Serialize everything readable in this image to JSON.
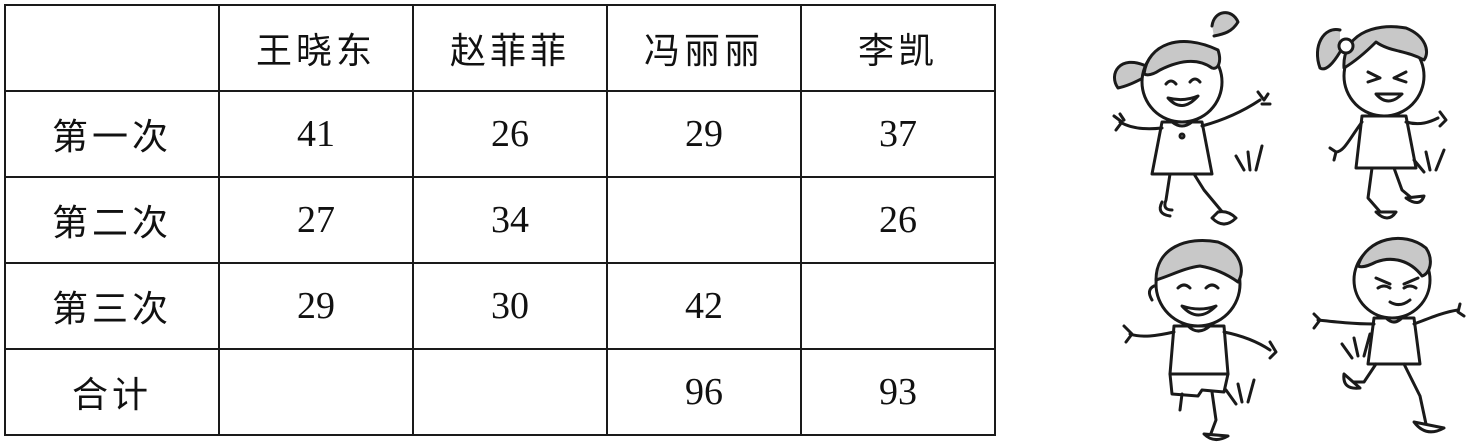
{
  "table": {
    "headers": [
      "",
      "王晓东",
      "赵菲菲",
      "冯丽丽",
      "李凯"
    ],
    "rows": [
      {
        "label": "第一次",
        "cells": [
          "41",
          "26",
          "29",
          "37"
        ]
      },
      {
        "label": "第二次",
        "cells": [
          "27",
          "34",
          "",
          "26"
        ]
      },
      {
        "label": "第三次",
        "cells": [
          "29",
          "30",
          "42",
          ""
        ]
      },
      {
        "label": "合计",
        "cells": [
          "",
          "",
          "96",
          "93"
        ]
      }
    ]
  },
  "illustration": {
    "figures": [
      "girl-pigtails",
      "girl-ponytail",
      "boy-jumping",
      "boy-running"
    ],
    "stroke_color": "#1a1a1a",
    "hair_color": "#c8c8c8"
  }
}
